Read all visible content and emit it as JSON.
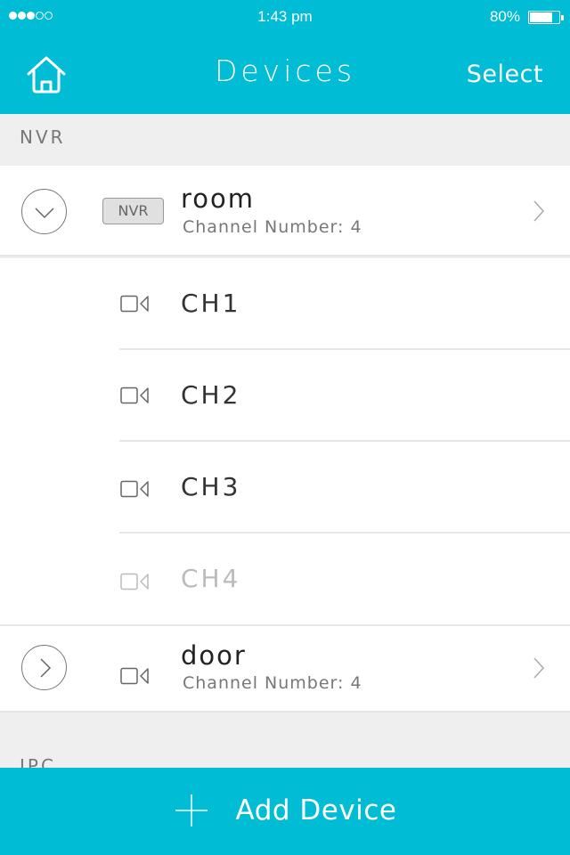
{
  "status_bar": {
    "signal_bars_filled": 3,
    "signal_bars_total": 5,
    "time": "1:43 pm",
    "battery_text": "80%",
    "battery_level": 0.8
  },
  "nav": {
    "home_icon": "home-icon",
    "title": "Devices",
    "select_label": "Select"
  },
  "sections": [
    {
      "label": "NVR",
      "devices": [
        {
          "name": "room",
          "type_badge": "NVR",
          "subtitle": "Channel Number:  4",
          "expanded": true,
          "channels": [
            {
              "label": "CH1",
              "enabled": true
            },
            {
              "label": "CH2",
              "enabled": true
            },
            {
              "label": "CH3",
              "enabled": true
            },
            {
              "label": "CH4",
              "enabled": false
            }
          ]
        },
        {
          "name": "door",
          "type_icon": "camera-icon",
          "subtitle": "Channel Number:  4",
          "expanded": false
        }
      ]
    },
    {
      "label": "IPC"
    }
  ],
  "footer": {
    "add_label": "Add Device",
    "icon": "plus-icon"
  },
  "colors": {
    "accent": "#00bcd4",
    "background": "#efefef",
    "disabled_text": "#bbbbbb"
  }
}
